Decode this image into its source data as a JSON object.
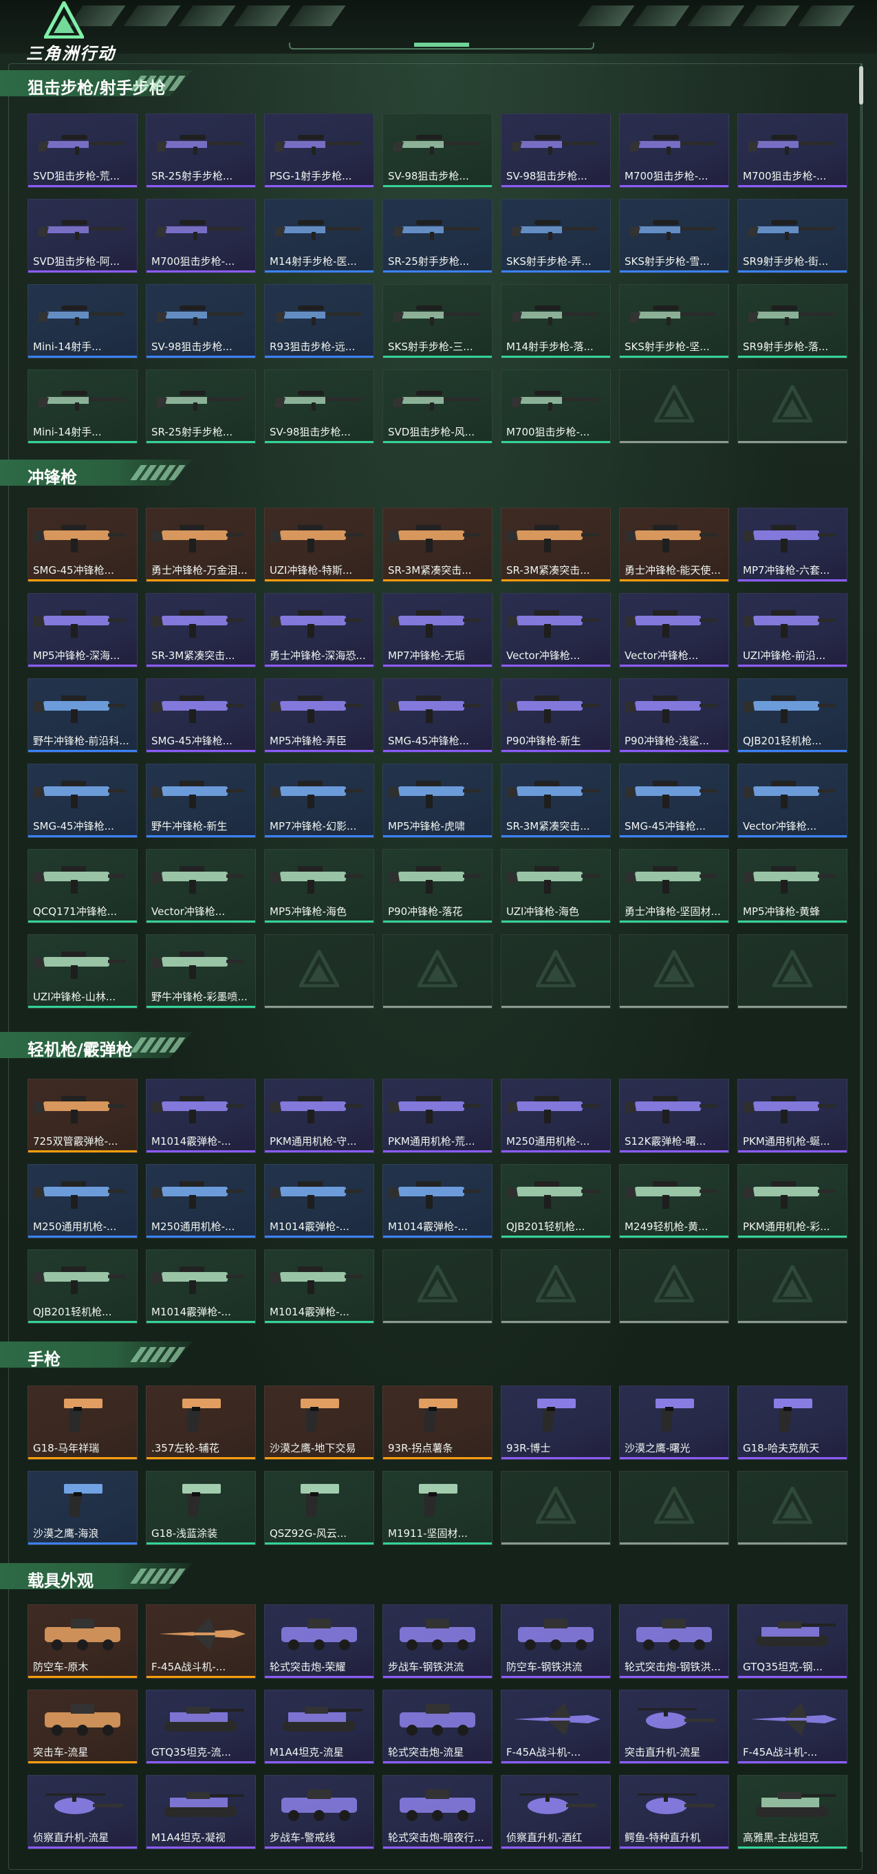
{
  "header": {
    "logo_text": "三角洲行动",
    "logo_icon": "delta-triangle-logo"
  },
  "colors": {
    "purple": "#8b5cf6",
    "blue": "#3b82f6",
    "green": "#34d399",
    "orange": "#f59e0b",
    "accent": "#2d6a45"
  },
  "sections": [
    {
      "title": "狙击步枪/射手步枪",
      "items": [
        {
          "label": "SVD狙击步枪-荒...",
          "rarity": "purple",
          "icon": "sniper-rifle-icon"
        },
        {
          "label": "SR-25射手步枪...",
          "rarity": "purple",
          "icon": "sniper-rifle-icon"
        },
        {
          "label": "PSG-1射手步枪...",
          "rarity": "purple",
          "icon": "sniper-rifle-icon"
        },
        {
          "label": "SV-98狙击步枪...",
          "rarity": "green",
          "icon": "sniper-rifle-icon"
        },
        {
          "label": "SV-98狙击步枪...",
          "rarity": "purple",
          "icon": "sniper-rifle-icon"
        },
        {
          "label": "M700狙击步枪-...",
          "rarity": "purple",
          "icon": "sniper-rifle-icon"
        },
        {
          "label": "M700狙击步枪-...",
          "rarity": "purple",
          "icon": "sniper-rifle-icon"
        },
        {
          "label": "SVD狙击步枪-阿...",
          "rarity": "purple",
          "icon": "sniper-rifle-icon"
        },
        {
          "label": "M700狙击步枪-...",
          "rarity": "purple",
          "icon": "sniper-rifle-icon"
        },
        {
          "label": "M14射手步枪-医...",
          "rarity": "blue",
          "icon": "sniper-rifle-icon"
        },
        {
          "label": "SR-25射手步枪...",
          "rarity": "blue",
          "icon": "sniper-rifle-icon"
        },
        {
          "label": "SKS射手步枪-弄...",
          "rarity": "blue",
          "icon": "sniper-rifle-icon"
        },
        {
          "label": "SKS射手步枪-雪...",
          "rarity": "blue",
          "icon": "sniper-rifle-icon"
        },
        {
          "label": "SR9射手步枪-街...",
          "rarity": "blue",
          "icon": "sniper-rifle-icon"
        },
        {
          "label": "Mini-14射手...",
          "rarity": "blue",
          "icon": "sniper-rifle-icon"
        },
        {
          "label": "SV-98狙击步枪...",
          "rarity": "blue",
          "icon": "sniper-rifle-icon"
        },
        {
          "label": "R93狙击步枪-远...",
          "rarity": "blue",
          "icon": "sniper-rifle-icon"
        },
        {
          "label": "SKS射手步枪-三...",
          "rarity": "green",
          "icon": "sniper-rifle-icon"
        },
        {
          "label": "M14射手步枪-落...",
          "rarity": "green",
          "icon": "sniper-rifle-icon"
        },
        {
          "label": "SKS射手步枪-坚...",
          "rarity": "green",
          "icon": "sniper-rifle-icon"
        },
        {
          "label": "SR9射手步枪-落...",
          "rarity": "green",
          "icon": "sniper-rifle-icon"
        },
        {
          "label": "Mini-14射手...",
          "rarity": "green",
          "icon": "sniper-rifle-icon"
        },
        {
          "label": "SR-25射手步枪...",
          "rarity": "green",
          "icon": "sniper-rifle-icon"
        },
        {
          "label": "SV-98狙击步枪...",
          "rarity": "green",
          "icon": "sniper-rifle-icon"
        },
        {
          "label": "SVD狙击步枪-风...",
          "rarity": "green",
          "icon": "sniper-rifle-icon"
        },
        {
          "label": "M700狙击步枪-...",
          "rarity": "green",
          "icon": "sniper-rifle-icon"
        },
        {
          "label": "",
          "rarity": "empty",
          "icon": ""
        },
        {
          "label": "",
          "rarity": "empty",
          "icon": ""
        }
      ]
    },
    {
      "title": "冲锋枪",
      "items": [
        {
          "label": "SMG-45冲锋枪...",
          "rarity": "orange",
          "icon": "submachine-gun-icon"
        },
        {
          "label": "勇士冲锋枪-万金泪...",
          "rarity": "orange",
          "icon": "submachine-gun-icon"
        },
        {
          "label": "UZI冲锋枪-特斯...",
          "rarity": "orange",
          "icon": "submachine-gun-icon"
        },
        {
          "label": "SR-3M紧凑突击...",
          "rarity": "orange",
          "icon": "submachine-gun-icon"
        },
        {
          "label": "SR-3M紧凑突击...",
          "rarity": "orange",
          "icon": "submachine-gun-icon"
        },
        {
          "label": "勇士冲锋枪-能天使...",
          "rarity": "orange",
          "icon": "submachine-gun-icon"
        },
        {
          "label": "MP7冲锋枪-六套...",
          "rarity": "purple",
          "icon": "submachine-gun-icon"
        },
        {
          "label": "MP5冲锋枪-深海...",
          "rarity": "purple",
          "icon": "submachine-gun-icon"
        },
        {
          "label": "SR-3M紧凑突击...",
          "rarity": "purple",
          "icon": "submachine-gun-icon"
        },
        {
          "label": "勇士冲锋枪-深海恐...",
          "rarity": "purple",
          "icon": "submachine-gun-icon"
        },
        {
          "label": "MP7冲锋枪-无垢",
          "rarity": "purple",
          "icon": "submachine-gun-icon"
        },
        {
          "label": "Vector冲锋枪...",
          "rarity": "purple",
          "icon": "submachine-gun-icon"
        },
        {
          "label": "Vector冲锋枪...",
          "rarity": "purple",
          "icon": "submachine-gun-icon"
        },
        {
          "label": "UZI冲锋枪-前沿...",
          "rarity": "purple",
          "icon": "submachine-gun-icon"
        },
        {
          "label": "野牛冲锋枪-前沿科...",
          "rarity": "blue",
          "icon": "submachine-gun-icon"
        },
        {
          "label": "SMG-45冲锋枪...",
          "rarity": "purple",
          "icon": "submachine-gun-icon"
        },
        {
          "label": "MP5冲锋枪-弄臣",
          "rarity": "purple",
          "icon": "submachine-gun-icon"
        },
        {
          "label": "SMG-45冲锋枪...",
          "rarity": "purple",
          "icon": "submachine-gun-icon"
        },
        {
          "label": "P90冲锋枪-新生",
          "rarity": "purple",
          "icon": "submachine-gun-icon"
        },
        {
          "label": "P90冲锋枪-浅鲨...",
          "rarity": "purple",
          "icon": "submachine-gun-icon"
        },
        {
          "label": "QJB201轻机枪...",
          "rarity": "blue",
          "icon": "submachine-gun-icon"
        },
        {
          "label": "SMG-45冲锋枪...",
          "rarity": "blue",
          "icon": "submachine-gun-icon"
        },
        {
          "label": "野牛冲锋枪-新生",
          "rarity": "blue",
          "icon": "submachine-gun-icon"
        },
        {
          "label": "MP7冲锋枪-幻影...",
          "rarity": "blue",
          "icon": "submachine-gun-icon"
        },
        {
          "label": "MP5冲锋枪-虎啸",
          "rarity": "blue",
          "icon": "submachine-gun-icon"
        },
        {
          "label": "SR-3M紧凑突击...",
          "rarity": "blue",
          "icon": "submachine-gun-icon"
        },
        {
          "label": "SMG-45冲锋枪...",
          "rarity": "blue",
          "icon": "submachine-gun-icon"
        },
        {
          "label": "Vector冲锋枪...",
          "rarity": "blue",
          "icon": "submachine-gun-icon"
        },
        {
          "label": "QCQ171冲锋枪...",
          "rarity": "green",
          "icon": "submachine-gun-icon"
        },
        {
          "label": "Vector冲锋枪...",
          "rarity": "green",
          "icon": "submachine-gun-icon"
        },
        {
          "label": "MP5冲锋枪-海色",
          "rarity": "green",
          "icon": "submachine-gun-icon"
        },
        {
          "label": "P90冲锋枪-落花",
          "rarity": "green",
          "icon": "submachine-gun-icon"
        },
        {
          "label": "UZI冲锋枪-海色",
          "rarity": "green",
          "icon": "submachine-gun-icon"
        },
        {
          "label": "勇士冲锋枪-坚固材...",
          "rarity": "green",
          "icon": "submachine-gun-icon"
        },
        {
          "label": "MP5冲锋枪-黄蜂",
          "rarity": "green",
          "icon": "submachine-gun-icon"
        },
        {
          "label": "UZI冲锋枪-山林...",
          "rarity": "green",
          "icon": "submachine-gun-icon"
        },
        {
          "label": "野牛冲锋枪-彩墨喷...",
          "rarity": "green",
          "icon": "submachine-gun-icon"
        },
        {
          "label": "",
          "rarity": "empty",
          "icon": ""
        },
        {
          "label": "",
          "rarity": "empty",
          "icon": ""
        },
        {
          "label": "",
          "rarity": "empty",
          "icon": ""
        },
        {
          "label": "",
          "rarity": "empty",
          "icon": ""
        },
        {
          "label": "",
          "rarity": "empty",
          "icon": ""
        }
      ]
    },
    {
      "title": "轻机枪/霰弹枪",
      "items": [
        {
          "label": "725双管霰弹枪-...",
          "rarity": "orange",
          "icon": "machine-gun-icon"
        },
        {
          "label": "M1014霰弹枪-...",
          "rarity": "purple",
          "icon": "shotgun-icon"
        },
        {
          "label": "PKM通用机枪-守...",
          "rarity": "purple",
          "icon": "machine-gun-icon"
        },
        {
          "label": "PKM通用机枪-荒...",
          "rarity": "purple",
          "icon": "machine-gun-icon"
        },
        {
          "label": "M250通用机枪-...",
          "rarity": "purple",
          "icon": "machine-gun-icon"
        },
        {
          "label": "S12K霰弹枪-曙...",
          "rarity": "purple",
          "icon": "shotgun-icon"
        },
        {
          "label": "PKM通用机枪-蜒...",
          "rarity": "purple",
          "icon": "machine-gun-icon"
        },
        {
          "label": "M250通用机枪-...",
          "rarity": "blue",
          "icon": "machine-gun-icon"
        },
        {
          "label": "M250通用机枪-...",
          "rarity": "blue",
          "icon": "machine-gun-icon"
        },
        {
          "label": "M1014霰弹枪-...",
          "rarity": "blue",
          "icon": "shotgun-icon"
        },
        {
          "label": "M1014霰弹枪-...",
          "rarity": "blue",
          "icon": "shotgun-icon"
        },
        {
          "label": "QJB201轻机枪...",
          "rarity": "green",
          "icon": "machine-gun-icon"
        },
        {
          "label": "M249轻机枪-黄...",
          "rarity": "green",
          "icon": "machine-gun-icon"
        },
        {
          "label": "PKM通用机枪-彩...",
          "rarity": "green",
          "icon": "machine-gun-icon"
        },
        {
          "label": "QJB201轻机枪...",
          "rarity": "green",
          "icon": "machine-gun-icon"
        },
        {
          "label": "M1014霰弹枪-...",
          "rarity": "green",
          "icon": "shotgun-icon"
        },
        {
          "label": "M1014霰弹枪-...",
          "rarity": "green",
          "icon": "shotgun-icon"
        },
        {
          "label": "",
          "rarity": "empty",
          "icon": ""
        },
        {
          "label": "",
          "rarity": "empty",
          "icon": ""
        },
        {
          "label": "",
          "rarity": "empty",
          "icon": ""
        },
        {
          "label": "",
          "rarity": "empty",
          "icon": ""
        }
      ]
    },
    {
      "title": "手枪",
      "items": [
        {
          "label": "G18-马年祥瑞",
          "rarity": "orange",
          "icon": "pistol-icon"
        },
        {
          "label": ".357左轮-辅花",
          "rarity": "orange",
          "icon": "pistol-icon"
        },
        {
          "label": "沙漠之鹰-地下交易",
          "rarity": "orange",
          "icon": "pistol-icon"
        },
        {
          "label": "93R-拐点薯条",
          "rarity": "orange",
          "icon": "pistol-icon"
        },
        {
          "label": "93R-博士",
          "rarity": "purple",
          "icon": "pistol-icon"
        },
        {
          "label": "沙漠之鹰-曙光",
          "rarity": "purple",
          "icon": "pistol-icon"
        },
        {
          "label": "G18-哈夫克航天",
          "rarity": "purple",
          "icon": "pistol-icon"
        },
        {
          "label": "沙漠之鹰-海浪",
          "rarity": "blue",
          "icon": "pistol-icon"
        },
        {
          "label": "G18-浅蓝涂装",
          "rarity": "green",
          "icon": "pistol-icon"
        },
        {
          "label": "QSZ92G-风云...",
          "rarity": "green",
          "icon": "pistol-icon"
        },
        {
          "label": "M1911-坚固材...",
          "rarity": "green",
          "icon": "pistol-icon"
        },
        {
          "label": "",
          "rarity": "empty",
          "icon": ""
        },
        {
          "label": "",
          "rarity": "empty",
          "icon": ""
        },
        {
          "label": "",
          "rarity": "empty",
          "icon": ""
        }
      ]
    },
    {
      "title": "载具外观",
      "items": [
        {
          "label": "防空车-原木",
          "rarity": "orange",
          "icon": "vehicle-icon"
        },
        {
          "label": "F-45A战斗机-...",
          "rarity": "orange",
          "icon": "jet-icon"
        },
        {
          "label": "轮式突击炮-荣耀",
          "rarity": "purple",
          "icon": "vehicle-icon"
        },
        {
          "label": "步战车-钢铁洪流",
          "rarity": "purple",
          "icon": "vehicle-icon"
        },
        {
          "label": "防空车-钢铁洪流",
          "rarity": "purple",
          "icon": "vehicle-icon"
        },
        {
          "label": "轮式突击炮-钢铁洪...",
          "rarity": "purple",
          "icon": "vehicle-icon"
        },
        {
          "label": "GTQ35坦克-钢...",
          "rarity": "purple",
          "icon": "tank-icon"
        },
        {
          "label": "突击车-流星",
          "rarity": "orange",
          "icon": "vehicle-icon"
        },
        {
          "label": "GTQ35坦克-流...",
          "rarity": "purple",
          "icon": "tank-icon"
        },
        {
          "label": "M1A4坦克-流星",
          "rarity": "purple",
          "icon": "tank-icon"
        },
        {
          "label": "轮式突击炮-流星",
          "rarity": "purple",
          "icon": "vehicle-icon"
        },
        {
          "label": "F-45A战斗机-...",
          "rarity": "purple",
          "icon": "jet-icon"
        },
        {
          "label": "突击直升机-流星",
          "rarity": "purple",
          "icon": "helicopter-icon"
        },
        {
          "label": "F-45A战斗机-...",
          "rarity": "purple",
          "icon": "jet-icon"
        },
        {
          "label": "侦察直升机-流星",
          "rarity": "purple",
          "icon": "helicopter-icon"
        },
        {
          "label": "M1A4坦克-凝视",
          "rarity": "purple",
          "icon": "tank-icon"
        },
        {
          "label": "步战车-警戒线",
          "rarity": "purple",
          "icon": "vehicle-icon"
        },
        {
          "label": "轮式突击炮-暗夜行...",
          "rarity": "purple",
          "icon": "vehicle-icon"
        },
        {
          "label": "侦察直升机-酒红",
          "rarity": "purple",
          "icon": "helicopter-icon"
        },
        {
          "label": "鳄鱼-特种直升机",
          "rarity": "purple",
          "icon": "helicopter-icon"
        },
        {
          "label": "高雅黑-主战坦克",
          "rarity": "green",
          "icon": "tank-icon"
        }
      ]
    }
  ]
}
